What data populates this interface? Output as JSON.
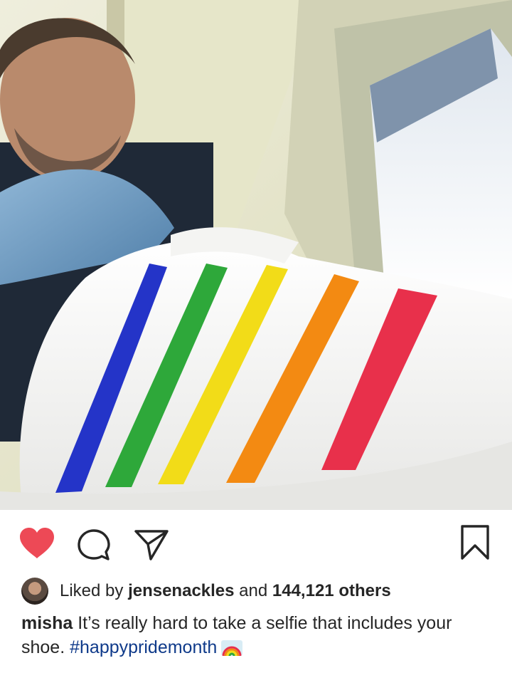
{
  "post": {
    "photo_description_icon": "photo",
    "actions": {
      "like_icon": "heart-filled-icon",
      "comment_icon": "comment-icon",
      "share_icon": "paper-plane-icon",
      "save_icon": "bookmark-icon",
      "like_color": "#ed4956"
    },
    "likes": {
      "prefix": "Liked by",
      "user": "jensenackles",
      "middle": "and",
      "count": "144,121 others"
    },
    "caption": {
      "username": "misha",
      "text": "It’s really hard to take a selfie that includes your shoe.",
      "hashtag": "#happypridemonth",
      "emoji_icon": "rainbow-emoji"
    }
  }
}
